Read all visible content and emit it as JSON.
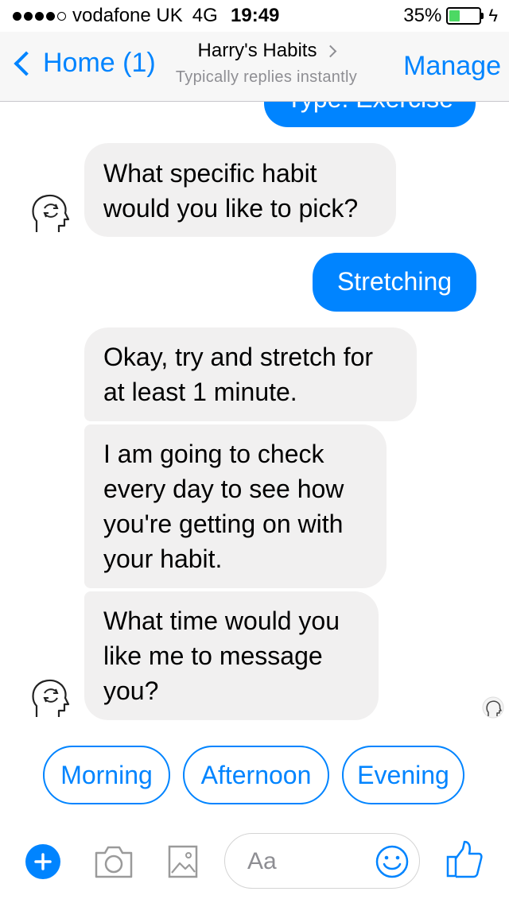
{
  "status_bar": {
    "carrier": "vodafone UK",
    "network": "4G",
    "time": "19:49",
    "battery": "35%",
    "battery_level": 0.35
  },
  "nav": {
    "back_label": "Home (1)",
    "title": "Harry's Habits",
    "subtitle": "Typically replies instantly",
    "manage_label": "Manage"
  },
  "messages": [
    {
      "from": "user",
      "text": "Type: Exercise"
    },
    {
      "from": "bot",
      "text": "What specific habit\nwould you like to pick?"
    },
    {
      "from": "user",
      "text": "Stretching"
    },
    {
      "from": "bot",
      "text": "Okay, try and stretch for\nat least 1 minute."
    },
    {
      "from": "bot",
      "text": "I am going to check\nevery day to see how\nyou're getting on with\nyour habit."
    },
    {
      "from": "bot",
      "text": "What time would you\nlike me to message\nyou?"
    }
  ],
  "quick_replies": [
    "Morning",
    "Afternoon",
    "Evening"
  ],
  "composer": {
    "placeholder": "Aa",
    "icons": [
      "plus-icon",
      "camera-icon",
      "gallery-icon",
      "emoji-icon",
      "like-icon"
    ]
  },
  "colors": {
    "accent": "#0084ff",
    "incoming_bubble": "#f1f0f0",
    "battery": "#4cd964"
  }
}
